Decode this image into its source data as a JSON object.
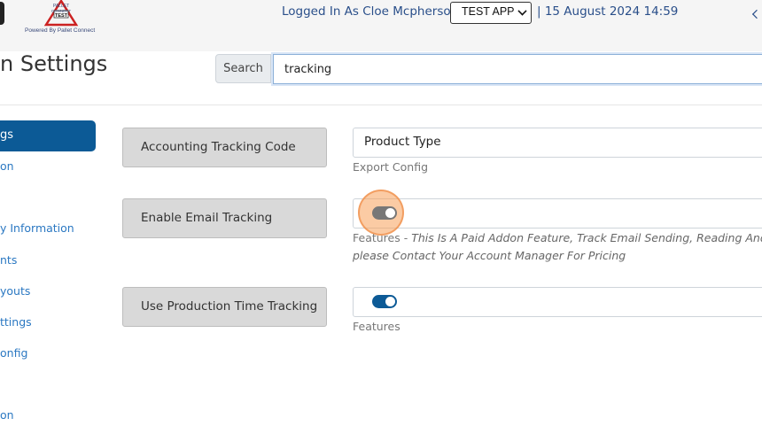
{
  "header": {
    "logo_word": "PALLET CONNECT",
    "logo_badge": "TEST",
    "powered_by": "Powered By Pallet Connect",
    "logged_in": "Logged In As Cloe Mcpherson |",
    "app_select": "TEST APP",
    "datetime": "| 15 August 2024 14:59"
  },
  "page": {
    "title": "n Settings",
    "search_button": "Search",
    "search_value": "tracking"
  },
  "sidebar": {
    "active_label": "gs",
    "items": [
      "on",
      "y Information",
      "nts",
      "youts",
      "ttings",
      "onfig",
      "on"
    ]
  },
  "settings": [
    {
      "label": "Accounting Tracking Code",
      "value": "Product Type",
      "help_category": "Export Config",
      "help_text": ""
    },
    {
      "label": "Enable Email Tracking",
      "toggle": "off",
      "help_category": "Features -",
      "help_text": "This Is A Paid Addon Feature, Track Email Sending, Reading And Fai",
      "help_text_2": "please Contact Your Account Manager For Pricing"
    },
    {
      "label": "Use Production Time Tracking",
      "toggle": "on",
      "help_category": "Features",
      "help_text": ""
    }
  ],
  "colors": {
    "accent": "#0c5a96",
    "link": "#2b78c2",
    "header_text": "#2a4f8a",
    "toggle_off": "#777777"
  }
}
